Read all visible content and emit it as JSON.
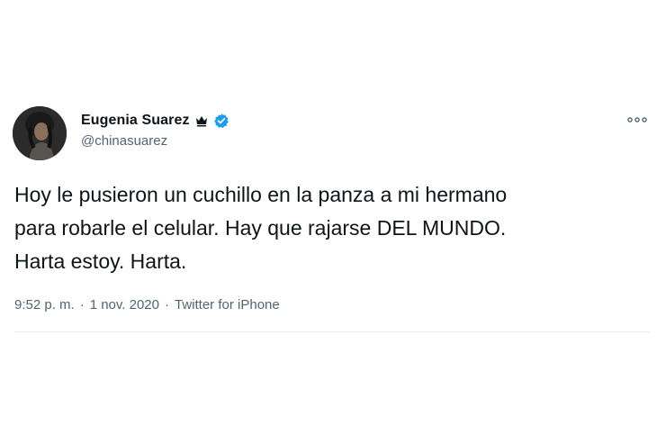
{
  "author": {
    "display_name": "Eugenia Suarez",
    "handle": "@chinasuarez",
    "crown_icon": "crown-icon",
    "verified_icon": "verified-badge-icon",
    "verified_color": "#1d9bf0"
  },
  "tweet": {
    "text": "Hoy le pusieron un cuchillo en la panza a mi hermano\npara robarle el celular. Hay que rajarse DEL MUNDO.\nHarta estoy. Harta."
  },
  "meta": {
    "time": "9:52 p. m.",
    "date": "1 nov. 2020",
    "separator": "·",
    "source": "Twitter for iPhone"
  },
  "menu": {
    "icon": "more-options-icon"
  }
}
